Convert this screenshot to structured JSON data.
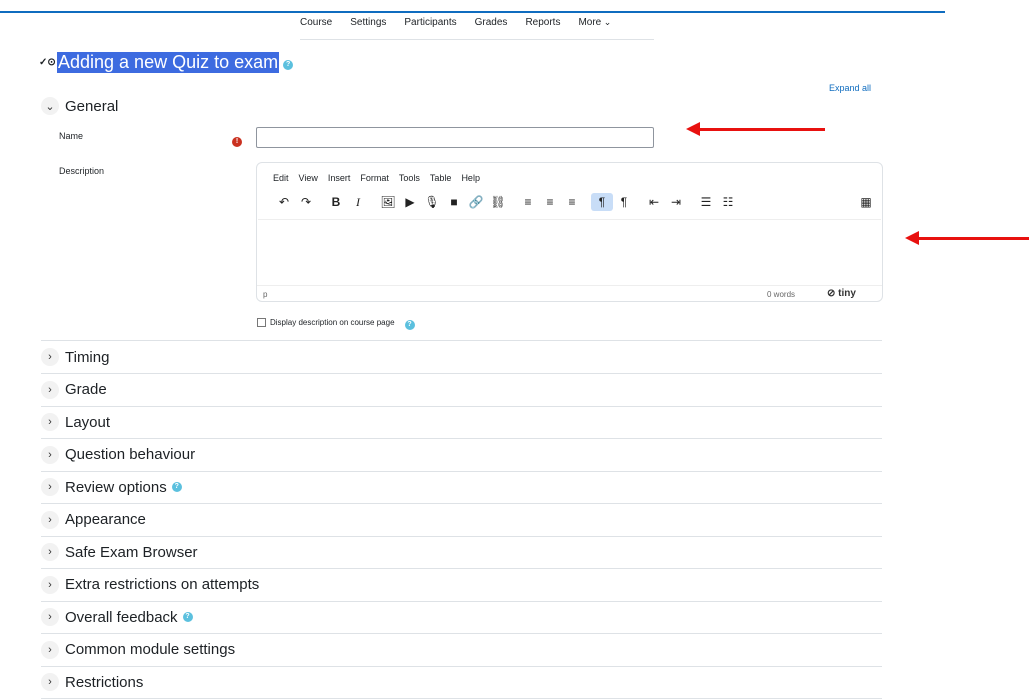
{
  "nav": {
    "tabs": [
      "Course",
      "Settings",
      "Participants",
      "Grades",
      "Reports",
      "More"
    ]
  },
  "page": {
    "title": "Adding a new Quiz to exam",
    "expand_all": "Expand all"
  },
  "general": {
    "heading": "General",
    "name_label": "Name",
    "name_value": "",
    "description_label": "Description",
    "display_description_label": "Display description on course page"
  },
  "editor": {
    "menu": [
      "Edit",
      "View",
      "Insert",
      "Format",
      "Tools",
      "Table",
      "Help"
    ],
    "path": "p",
    "word_count": "0 words",
    "brand": "tiny"
  },
  "sections": [
    {
      "label": "Timing",
      "help": false
    },
    {
      "label": "Grade",
      "help": false
    },
    {
      "label": "Layout",
      "help": false
    },
    {
      "label": "Question behaviour",
      "help": false
    },
    {
      "label": "Review options",
      "help": true
    },
    {
      "label": "Appearance",
      "help": false
    },
    {
      "label": "Safe Exam Browser",
      "help": false
    },
    {
      "label": "Extra restrictions on attempts",
      "help": false
    },
    {
      "label": "Overall feedback",
      "help": true
    },
    {
      "label": "Common module settings",
      "help": false
    },
    {
      "label": "Restrictions",
      "help": false
    }
  ],
  "colors": {
    "title_highlight": "#3d6be0",
    "annotation_arrow": "#e8110f",
    "required_icon": "#ca3120",
    "help_icon": "#5bc0de"
  }
}
